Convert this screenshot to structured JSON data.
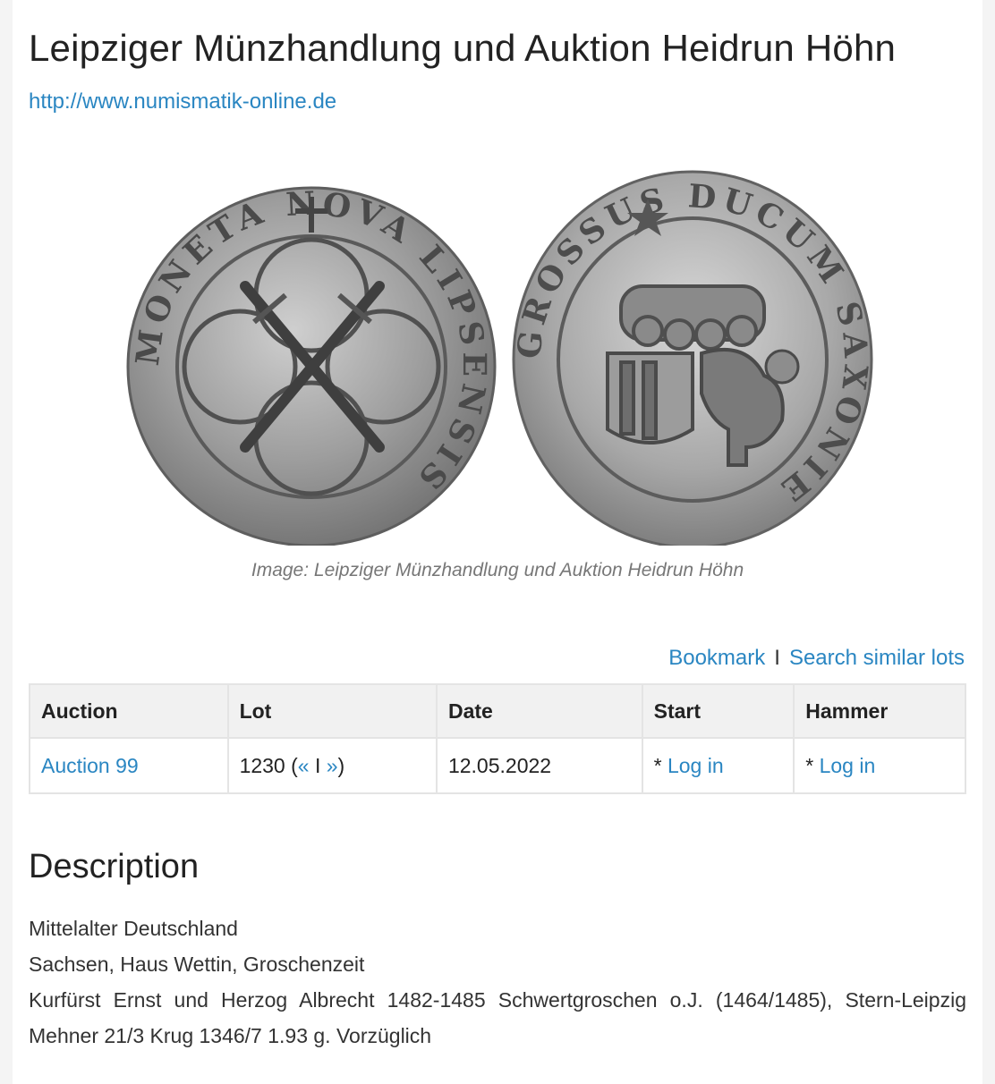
{
  "header": {
    "title": "Leipziger Münzhandlung und Auktion Heidrun Höhn",
    "url": "http://www.numismatik-online.de"
  },
  "image": {
    "caption": "Image: Leipziger Münzhandlung und Auktion Heidrun Höhn",
    "obverse_legend": "MONETA NOVA LIPSENSIS",
    "reverse_legend": "GROSSUS DUCUM SAXONIE"
  },
  "actions": {
    "bookmark": "Bookmark",
    "separator": "I",
    "search_similar": "Search similar lots"
  },
  "lot_table": {
    "headers": [
      "Auction",
      "Lot",
      "Date",
      "Start",
      "Hammer"
    ],
    "auction": "Auction 99",
    "lot_number": "1230 (",
    "lot_prev": "«",
    "lot_sep": " I ",
    "lot_next": "»",
    "lot_close": ")",
    "date": "12.05.2022",
    "start_prefix": "* ",
    "start_link": "Log in",
    "hammer_prefix": "* ",
    "hammer_link": "Log in"
  },
  "description": {
    "heading": "Description",
    "lines": [
      "Mittelalter Deutschland",
      "Sachsen, Haus Wettin, Groschenzeit",
      "Kurfürst Ernst und Herzog Albrecht 1482-1485 Schwertgroschen o.J. (1464/1485), Stern-Leipzig Mehner 21/3 Krug 1346/7 1.93 g. Vorzüglich"
    ]
  }
}
